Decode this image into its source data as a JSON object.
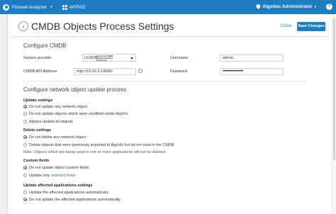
{
  "topbar": {
    "app_name": "Firewall Analyzer",
    "switch_app": "APPVIZ",
    "user": "AlgoSec Administrator",
    "help": "?"
  },
  "header": {
    "back": "‹",
    "title": "CMDB Objects Process Settings",
    "close": "Close",
    "save": "Save Changes"
  },
  "configure": {
    "title": "Configure CMDB",
    "service_provider_label": "Service provider",
    "service_provider_value": "UCMDB",
    "service_provider_subtitle": [
      "Universal CMDB",
      "Hewlett Packard",
      "Enterprise"
    ],
    "api_address_label": "CMDB API Address",
    "api_address_value": "http://10.20.3.3:8080",
    "info_icon": "i",
    "username_label": "Username",
    "username_value": "admin",
    "password_label": "Password",
    "password_value": "••••••••••••••••••"
  },
  "update_process": {
    "title": "Configure network object update process",
    "update_settings": {
      "heading": "Update settings",
      "options": [
        "Do not update any network object",
        "Do not update objects which were modified inside AppViz",
        "Always update all objects"
      ],
      "selected": 0
    },
    "delete_settings": {
      "heading": "Delete settings",
      "options": [
        "Do not delete any network object",
        "Delete objects that were previously imported to AppViz but do not exist in the CMDB"
      ],
      "selected": 0,
      "note": "Note: Objects which are being used in one or more applications will not be deleted"
    },
    "custom_fields": {
      "heading": "Custom fields",
      "options": [
        "Do not update object custom fields",
        "Update only"
      ],
      "selected_fields_link": "selected fields",
      "selected": 0
    },
    "affected_apps": {
      "heading": "Update affected applications settings",
      "options": [
        "Update the affected applications automatically",
        "Do not update the affected applications automatically"
      ],
      "selected": 1
    }
  }
}
